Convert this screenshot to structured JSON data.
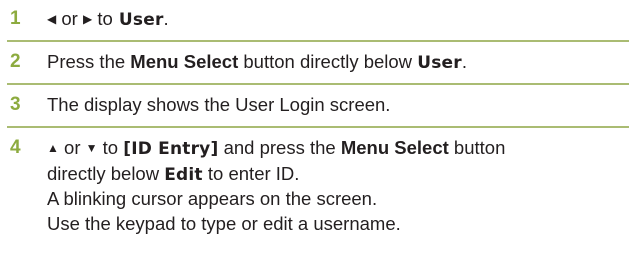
{
  "steps": [
    {
      "number": "1",
      "arrow_left": "◀",
      "or": "or",
      "arrow_right": "▶",
      "to": "to",
      "target": "User",
      "end": "."
    },
    {
      "number": "2",
      "pre": "Press the",
      "button": "Menu Select",
      "mid": "button directly below",
      "target": "User",
      "end": "."
    },
    {
      "number": "3",
      "text": "The display shows the User Login screen."
    },
    {
      "number": "4",
      "arrow_up": "▲",
      "or": "or",
      "arrow_down": "▼",
      "to": "to",
      "target": "[ID Entry]",
      "mid": "and press the",
      "button": "Menu Select",
      "tail": "button",
      "line2_pre": "directly below",
      "line2_target": "Edit",
      "line2_post": "to enter ID.",
      "line3": "A blinking cursor appears on the screen.",
      "line4": "Use the keypad to type or edit a username."
    }
  ],
  "colors": {
    "step_number": "#8dab3f",
    "divider": "#aabc73",
    "text": "#231f20"
  }
}
